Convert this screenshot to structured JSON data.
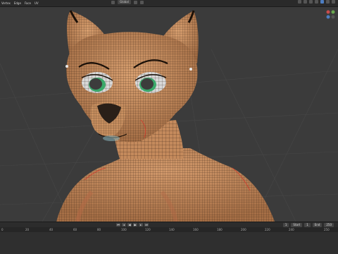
{
  "header": {
    "menu": [
      "Vertex",
      "Edge",
      "Face",
      "UV"
    ],
    "mode_label": "Shading",
    "viewport_label": "Global"
  },
  "timeline": {
    "current_frame": "1",
    "start_label": "Start",
    "start_value": "1",
    "end_label": "End",
    "end_value": "250",
    "ticks": [
      "0",
      "20",
      "40",
      "60",
      "80",
      "100",
      "120",
      "140",
      "160",
      "180",
      "200",
      "220",
      "240",
      "250"
    ]
  },
  "colors": {
    "skin": "#c78c5e",
    "wire": "#2b1b0f",
    "seam": "#d43a2a",
    "eye_green": "#3aa86a",
    "accent": "#4d7ec2"
  },
  "icons": [
    "cursor-icon",
    "move-icon",
    "rotate-icon",
    "camera-icon",
    "hand-icon",
    "zoom-icon",
    "play-icon",
    "jump-start-icon",
    "jump-end-icon",
    "prev-key-icon",
    "next-key-icon"
  ]
}
